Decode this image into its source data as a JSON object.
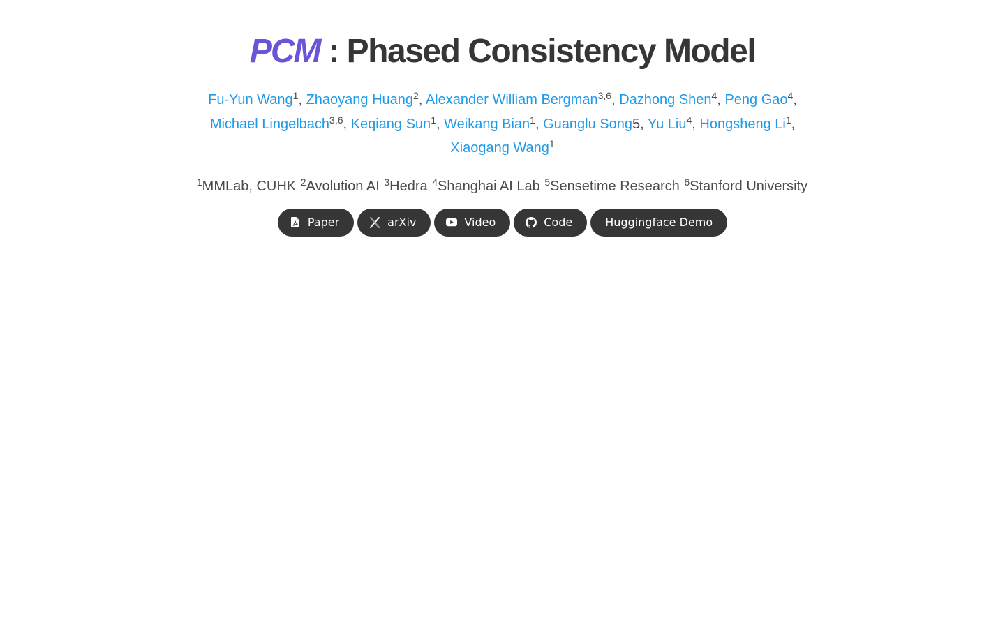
{
  "title": {
    "abbr": "PCM",
    "rest": ": Phased Consistency Model"
  },
  "authors": [
    {
      "name": "Fu-Yun Wang",
      "sup": "1",
      "sep": ", "
    },
    {
      "name": "Zhaoyang Huang",
      "sup": "2",
      "sep": ", "
    },
    {
      "name": "Alexander William Bergman",
      "sup": "3,6",
      "sep": ", "
    },
    {
      "name": "Dazhong Shen",
      "sup": "4",
      "sep": ", "
    },
    {
      "name": "Peng Gao",
      "sup": "4",
      "sep": ","
    },
    {
      "name": "Michael Lingelbach",
      "sup": "3,6",
      "sep": ", "
    },
    {
      "name": "Keqiang Sun",
      "sup": "1",
      "sep": ", "
    },
    {
      "name": "Weikang Bian",
      "sup": "1",
      "sep": ", "
    },
    {
      "name": "Guanglu Song",
      "suffix": "5",
      "sep": ", "
    },
    {
      "name": "Yu Liu",
      "sup": "4",
      "sep": ", "
    },
    {
      "name": "Hongsheng Li",
      "sup": "1",
      "sep": ","
    },
    {
      "name": "Xiaogang Wang",
      "sup": "1",
      "sep": ""
    }
  ],
  "affiliations": [
    {
      "num": "1",
      "name": "MMLab, CUHK"
    },
    {
      "num": "2",
      "name": "Avolution AI"
    },
    {
      "num": "3",
      "name": "Hedra"
    },
    {
      "num": "4",
      "name": "Shanghai AI Lab"
    },
    {
      "num": "5",
      "name": "Sensetime Research"
    },
    {
      "num": "6",
      "name": "Stanford University"
    }
  ],
  "links": [
    {
      "label": "Paper",
      "icon": "file-pdf-icon"
    },
    {
      "label": "arXiv",
      "icon": "arxiv-icon"
    },
    {
      "label": "Video",
      "icon": "youtube-icon"
    },
    {
      "label": "Code",
      "icon": "github-icon"
    },
    {
      "label": "Huggingface Demo",
      "icon": ""
    }
  ],
  "colors": {
    "abbr": "#6a55d8",
    "link": "#1f9ae8",
    "text": "#363636",
    "button_bg": "#363636"
  }
}
